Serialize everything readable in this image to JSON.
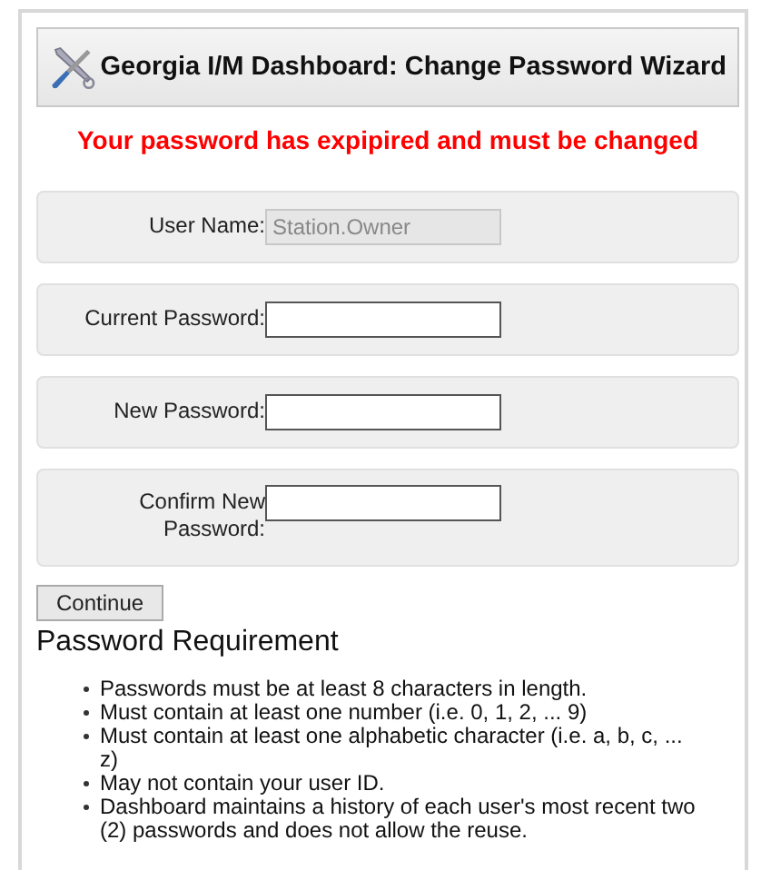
{
  "header": {
    "title": "Georgia I/M Dashboard: Change Password Wizard"
  },
  "message": "Your password has expipired and must be changed",
  "fields": [
    {
      "label": "User Name:",
      "value": "Station.Owner",
      "disabled": true
    },
    {
      "label": "Current Password:",
      "disabled": false
    },
    {
      "label": "New Password:",
      "disabled": false
    },
    {
      "label": "Confirm New Password:",
      "disabled": false
    }
  ],
  "continue_button": "Continue",
  "requirements": {
    "title": "Password Requirement",
    "items": [
      "Passwords must be at least 8 characters in length.",
      "Must contain at least one number (i.e. 0, 1, 2, ... 9)",
      "Must contain at least one alphabetic character (i.e. a, b, c, ... z)",
      "May not contain your user ID.",
      "Dashboard maintains a history of each user's most recent two (2) passwords and does not allow the reuse."
    ]
  }
}
